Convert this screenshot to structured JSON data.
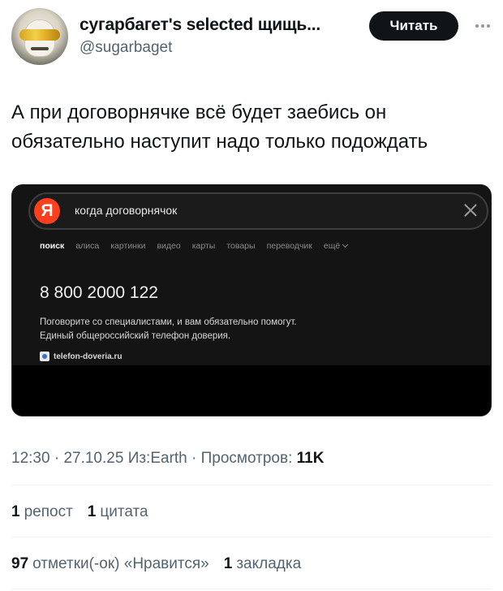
{
  "author": {
    "display_name": "сугарбагет's selected щищь...",
    "handle": "@sugarbaget",
    "avatar_icon": "avatar-masked-figure-gold-goggles"
  },
  "follow_button": {
    "label": "Читать"
  },
  "more_icon": "more-horizontal-icon",
  "tweet": {
    "text": "А при договорнячке всё будет заебись он обязательно наступит надо только подождать"
  },
  "media": {
    "search_logo": "Я",
    "search_query": "когда договорнячок",
    "tabs": [
      "поиск",
      "алиса",
      "картинки",
      "видео",
      "карты",
      "товары",
      "переводчик",
      "ещё"
    ],
    "active_tab": "поиск",
    "result_phone": "8 800 2000 122",
    "result_desc_line1": "Поговорите со специалистами, и вам обязательно помогут.",
    "result_desc_line2": "Единый общероссийский телефон доверия.",
    "result_site": "telefon-doveria.ru"
  },
  "meta": {
    "time": "12:30",
    "date": "27.10.25",
    "source": "Из:Earth",
    "views_label": "Просмотров:",
    "views_count": "11K"
  },
  "stats": {
    "reposts_count": "1",
    "reposts_label": "репост",
    "quotes_count": "1",
    "quotes_label": "цитата",
    "likes_count": "97",
    "likes_label": "отметки(-ок) «Нравится»",
    "bookmarks_count": "1",
    "bookmarks_label": "закладка"
  },
  "colors": {
    "text_primary": "#0f1419",
    "text_secondary": "#536471",
    "follow_bg": "#0f1419",
    "yandex_red": "#fc3f1d",
    "media_bg": "#141414"
  }
}
